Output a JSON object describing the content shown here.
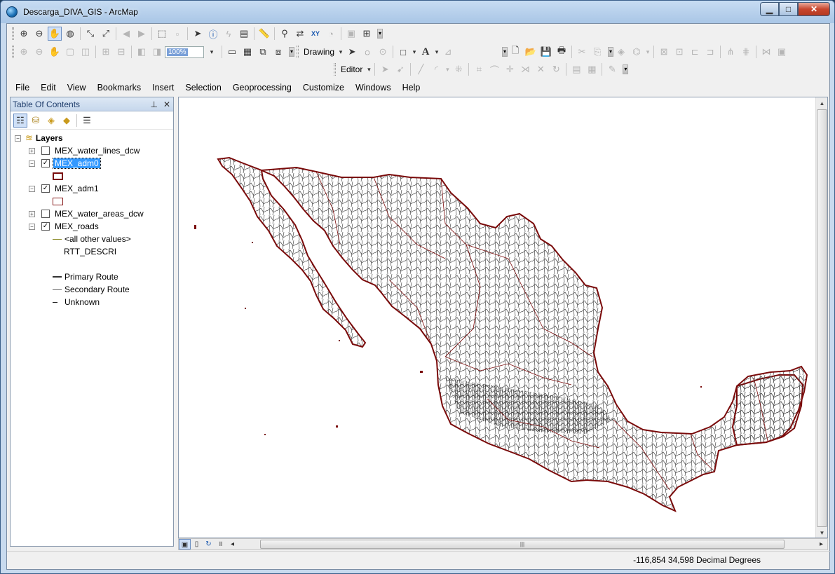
{
  "window": {
    "title": "Descarga_DIVA_GIS - ArcMap",
    "minimize": "▁",
    "maximize": "□",
    "close": "✕"
  },
  "toolbars": {
    "scale_value": "100%",
    "drawing_label": "Drawing",
    "editor_label": "Editor"
  },
  "menu": [
    "File",
    "Edit",
    "View",
    "Bookmarks",
    "Insert",
    "Selection",
    "Geoprocessing",
    "Customize",
    "Windows",
    "Help"
  ],
  "toc": {
    "title": "Table Of Contents",
    "pin": "⊥",
    "close": "✕",
    "root": "Layers",
    "layers": [
      {
        "name": "MEX_water_lines_dcw",
        "checked": false,
        "expanded": false
      },
      {
        "name": "MEX_adm0",
        "checked": true,
        "expanded": true
      },
      {
        "name": "MEX_adm1",
        "checked": true,
        "expanded": true
      },
      {
        "name": "MEX_water_areas_dcw",
        "checked": false,
        "expanded": false
      },
      {
        "name": "MEX_roads",
        "checked": true,
        "expanded": true
      }
    ],
    "roads_legend": {
      "other": "<all other values>",
      "field": "RTT_DESCRI",
      "classes": [
        "Primary Route",
        "Secondary Route",
        "Unknown"
      ]
    }
  },
  "status": {
    "coordinates": "-116,854  34,598 Decimal Degrees"
  },
  "colors": {
    "boundary": "#7a0a0a",
    "roads": "#3a3a3a",
    "selection": "#3399ff"
  }
}
